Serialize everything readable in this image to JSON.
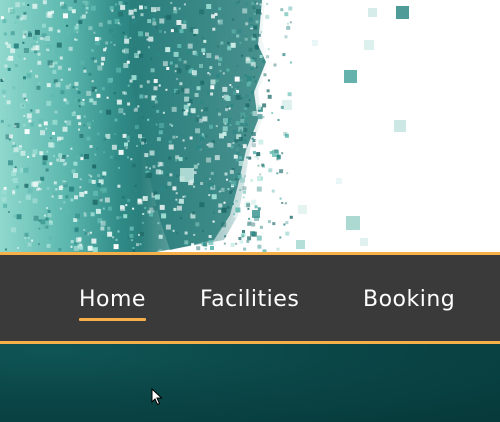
{
  "hero": {
    "image": "teal-pixelated-aerial-map"
  },
  "nav": {
    "items": [
      {
        "label": "Home",
        "active": true
      },
      {
        "label": "Facilities",
        "active": false
      },
      {
        "label": "Booking",
        "active": false
      }
    ]
  },
  "colors": {
    "accent": "#f5b04a",
    "navbar_bg": "#3a3a3a",
    "teal_dark": "#06393a",
    "teal_mid": "#3a9c98",
    "teal_light": "#7fd3c8"
  },
  "cursor": {
    "icon": "arrow-pointer-icon"
  }
}
